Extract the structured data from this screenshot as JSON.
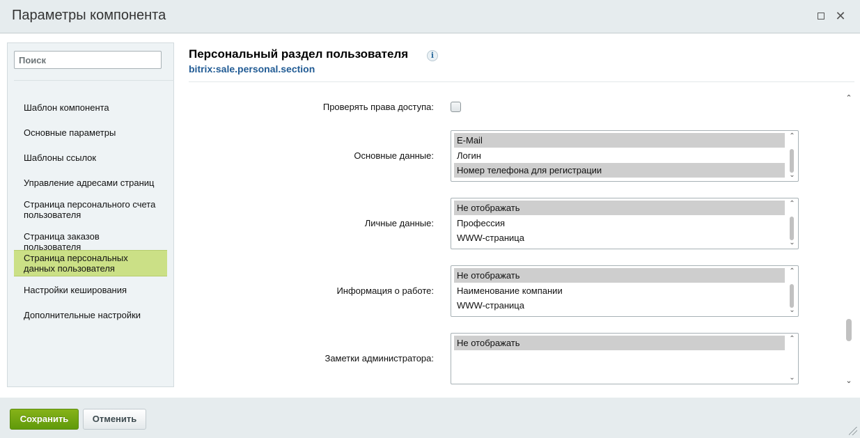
{
  "window": {
    "title": "Параметры компонента",
    "maximize_icon": "maximize-icon",
    "close_icon": "close-icon",
    "close_glyph": "✕"
  },
  "sidebar": {
    "search": {
      "placeholder": "Поиск",
      "value": ""
    },
    "items": [
      {
        "label": "Шаблон компонента",
        "active": false
      },
      {
        "label": "Основные параметры",
        "active": false
      },
      {
        "label": "Шаблоны ссылок",
        "active": false
      },
      {
        "label": "Управление адресами страниц",
        "active": false
      },
      {
        "label": "Страница персонального счета пользователя",
        "active": false
      },
      {
        "label": "Страница заказов пользователя",
        "active": false
      },
      {
        "label": "Страница персональных данных пользователя",
        "active": true
      },
      {
        "label": "Настройки кеширования",
        "active": false
      },
      {
        "label": "Дополнительные настройки",
        "active": false
      }
    ]
  },
  "main": {
    "component_title": "Персональный раздел пользователя",
    "component_code": "bitrix:sale.personal.section",
    "info_glyph": "i",
    "params": [
      {
        "label": "Проверять права доступа:",
        "type": "checkbox",
        "checked": false
      },
      {
        "label": "Основные данные:",
        "type": "multiselect",
        "options": [
          {
            "text": "E-Mail",
            "selected": true
          },
          {
            "text": "Логин",
            "selected": false
          },
          {
            "text": "Номер телефона для регистрации",
            "selected": true
          }
        ]
      },
      {
        "label": "Личные данные:",
        "type": "multiselect",
        "options": [
          {
            "text": "Не отображать",
            "selected": true
          },
          {
            "text": "Профессия",
            "selected": false
          },
          {
            "text": "WWW-страница",
            "selected": false
          }
        ]
      },
      {
        "label": "Информация о работе:",
        "type": "multiselect",
        "options": [
          {
            "text": "Не отображать",
            "selected": true
          },
          {
            "text": "Наименование компании",
            "selected": false
          },
          {
            "text": "WWW-страница",
            "selected": false
          }
        ]
      },
      {
        "label": "Заметки администратора:",
        "type": "multiselect",
        "options": [
          {
            "text": "Не отображать",
            "selected": true
          }
        ]
      }
    ],
    "scroll_up_glyph": "⌃",
    "scroll_down_glyph": "⌄"
  },
  "footer": {
    "save_label": "Сохранить",
    "cancel_label": "Отменить"
  },
  "colors": {
    "accent_green": "#6aa30f",
    "active_item": "#cbe086",
    "link_blue": "#215b94",
    "selected_option": "#cecece"
  }
}
